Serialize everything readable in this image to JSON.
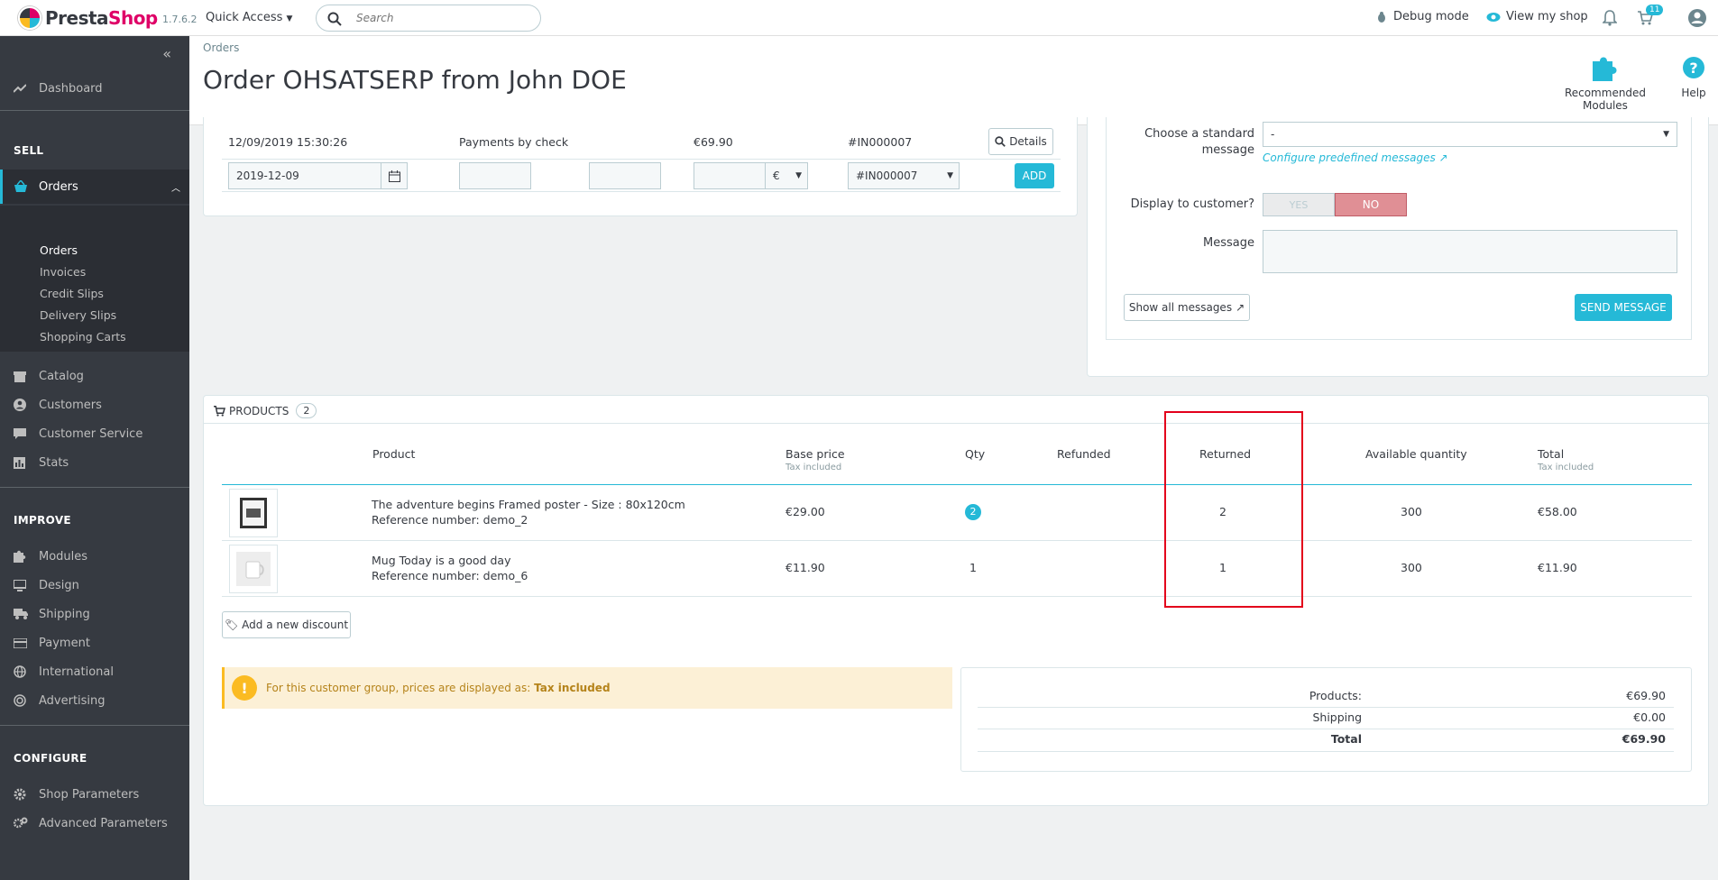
{
  "topbar": {
    "logo_presta": "Presta",
    "logo_shop": "Shop",
    "version": "1.7.6.2",
    "quick_access": "Quick Access",
    "search_placeholder": "Search",
    "debug_mode": "Debug mode",
    "view_my_shop": "View my shop",
    "orders_badge": "11"
  },
  "sidebar": {
    "dashboard": "Dashboard",
    "section_sell": "SELL",
    "orders": "Orders",
    "sub_orders": "Orders",
    "sub_invoices": "Invoices",
    "sub_credit_slips": "Credit Slips",
    "sub_delivery_slips": "Delivery Slips",
    "sub_shopping_carts": "Shopping Carts",
    "catalog": "Catalog",
    "customers": "Customers",
    "customer_service": "Customer Service",
    "stats": "Stats",
    "section_improve": "IMPROVE",
    "modules": "Modules",
    "design": "Design",
    "shipping": "Shipping",
    "payment": "Payment",
    "international": "International",
    "advertising": "Advertising",
    "section_configure": "CONFIGURE",
    "shop_parameters": "Shop Parameters",
    "advanced_parameters": "Advanced Parameters"
  },
  "header": {
    "breadcrumb": "Orders",
    "title": "Order OHSATSERP from John DOE",
    "recommended_modules": "Recommended Modules",
    "help": "Help"
  },
  "payment": {
    "row_date": "12/09/2019 15:30:26",
    "row_method": "Payments by check",
    "row_amount": "€69.90",
    "row_invoice": "#IN000007",
    "details_label": "Details",
    "date_input": "2019-12-09",
    "currency": "€",
    "invoice_select": "#IN000007",
    "add_label": "ADD"
  },
  "messages": {
    "choose_label_1": "Choose a standard",
    "choose_label_2": "message",
    "choose_value": "-",
    "configure_link": "Configure predefined messages",
    "display_label": "Display to customer?",
    "yes": "YES",
    "no": "NO",
    "message_label": "Message",
    "show_all": "Show all messages",
    "send": "SEND MESSAGE"
  },
  "products": {
    "title": "PRODUCTS",
    "count": "2",
    "headers": {
      "product": "Product",
      "base_price": "Base price",
      "base_price_sub": "Tax included",
      "qty": "Qty",
      "refunded": "Refunded",
      "returned": "Returned",
      "available": "Available quantity",
      "total": "Total",
      "total_sub": "Tax included"
    },
    "rows": [
      {
        "name": "The adventure begins Framed poster - Size : 80x120cm",
        "ref": "Reference number: demo_2",
        "base_price": "€29.00",
        "qty": "2",
        "refunded": "",
        "returned": "2",
        "available": "300",
        "total": "€58.00"
      },
      {
        "name": "Mug Today is a good day",
        "ref": "Reference number: demo_6",
        "base_price": "€11.90",
        "qty": "1",
        "refunded": "",
        "returned": "1",
        "available": "300",
        "total": "€11.90"
      }
    ],
    "add_discount": "Add a new discount",
    "tax_notice": "For this customer group, prices are displayed as:",
    "tax_notice_bold": "Tax included"
  },
  "totals": {
    "products_label": "Products:",
    "products_value": "€69.90",
    "shipping_label": "Shipping",
    "shipping_value": "€0.00",
    "total_label": "Total",
    "total_value": "€69.90"
  },
  "colors": {
    "accent": "#25b9d7",
    "brand": "#df0067",
    "sidebar": "#363a41",
    "highlight": "#e3001b"
  }
}
